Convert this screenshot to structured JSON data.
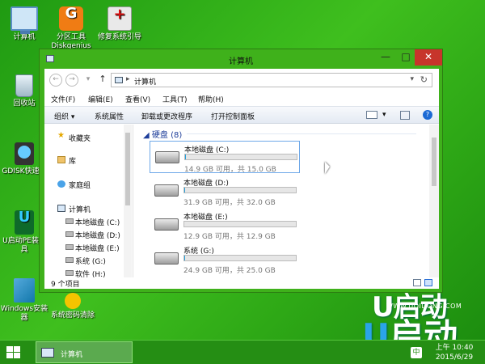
{
  "desktop": {
    "icons": [
      {
        "label": "计算机",
        "icon": "computer-icon"
      },
      {
        "label": "分区工具Diskgenius",
        "icon": "diskgenius-icon",
        "glyph": "G"
      },
      {
        "label": "修复系统引导",
        "icon": "repair-icon",
        "glyph": "+"
      },
      {
        "label": "回收站",
        "icon": "recycle-bin-icon"
      },
      {
        "label": "GDISK快速区",
        "icon": "gdisk-icon"
      },
      {
        "label": "U启动PE装工具",
        "icon": "upe-icon",
        "glyph": "U"
      },
      {
        "label": "Windows安装器",
        "icon": "windows-installer-icon"
      },
      {
        "label": "系统密码清除",
        "icon": "key-icon"
      }
    ],
    "brand_small": "U启动",
    "brand_url": "WWW.UQIDONG.COM",
    "brand_big_u": "U",
    "brand_big": "启动"
  },
  "window": {
    "title": "计算机",
    "min_glyph": "—",
    "max_glyph": "□",
    "close_glyph": "✕",
    "address": {
      "back_glyph": "←",
      "forward_glyph": "→",
      "history_glyph": "▾",
      "up_glyph": "↑",
      "sep": "▸",
      "path": "计算机",
      "dropdown_glyph": "▾",
      "refresh_glyph": "↻"
    },
    "menus": [
      "文件(F)",
      "编辑(E)",
      "查看(V)",
      "工具(T)",
      "帮助(H)"
    ],
    "commands": {
      "organize": "组织 ▾",
      "items": [
        "系统属性",
        "卸载或更改程序",
        "打开控制面板"
      ],
      "view_dd": "▾",
      "help": "?"
    },
    "nav": {
      "favorites": "收藏夹",
      "libraries": "库",
      "homegroup": "家庭组",
      "computer": "计算机",
      "drives": [
        "本地磁盘 (C:)",
        "本地磁盘 (D:)",
        "本地磁盘 (E:)",
        "系统 (G:)",
        "软件 (H:)"
      ]
    },
    "group_label": "硬盘 (8)",
    "group_toggle": "◢",
    "drives": [
      {
        "name": "本地磁盘 (C:)",
        "info": "14.9 GB 可用，共 15.0 GB",
        "used_fraction": 0.01
      },
      {
        "name": "本地磁盘 (D:)",
        "info": "31.9 GB 可用，共 32.0 GB",
        "used_fraction": 0.01
      },
      {
        "name": "本地磁盘 (E:)",
        "info": "12.9 GB 可用，共 12.9 GB",
        "used_fraction": 0.0
      },
      {
        "name": "系统 (G:)",
        "info": "24.9 GB 可用，共 25.0 GB",
        "used_fraction": 0.01
      }
    ],
    "status": "9 个项目"
  },
  "taskbar": {
    "task_label": "计算机",
    "lang": "中",
    "time": "上午 10:40",
    "date": "2015/6/29"
  },
  "colors": {
    "desktop": "#2ea816",
    "window_frame": "#3fb11b",
    "close_button": "#c7352b",
    "drive_bar_fill": "#26a0da",
    "group_heading": "#1e3e9a"
  }
}
